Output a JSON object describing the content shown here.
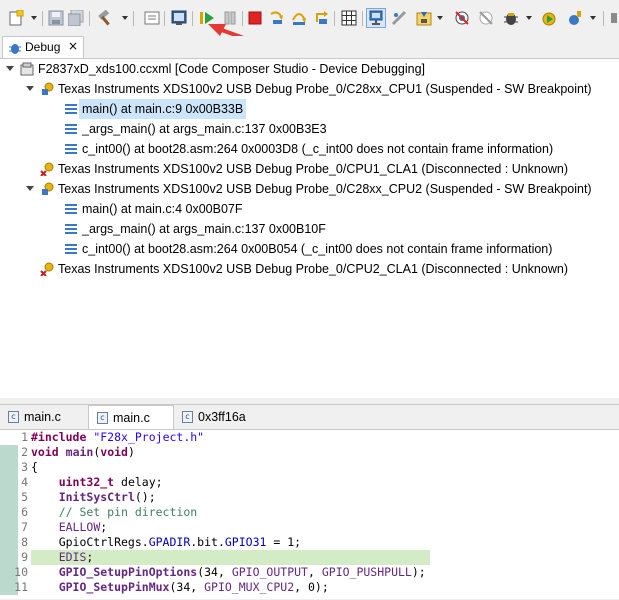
{
  "toolbar": {
    "buttons": [
      "new-icon",
      "save-icon",
      "save-all-icon",
      "build-hammer-icon",
      "properties-icon",
      "terminal-icon",
      "resume-icon",
      "suspend-icon",
      "terminate-icon",
      "step-into-icon",
      "step-over-icon",
      "step-return-icon",
      "memory-grid-icon",
      "connect-target-icon",
      "load-program-icon",
      "disable-breakpoints-icon",
      "skip-breakpoints-icon",
      "debug-bug-icon",
      "run-icon",
      "external-tools-icon"
    ]
  },
  "debug_view": {
    "tab_label": "Debug",
    "close_glyph": "×",
    "tree": [
      {
        "text": "F2837xD_xds100.ccxml [Code Composer Studio - Device Debugging]",
        "icon": "debug-config-icon",
        "level": 0
      },
      {
        "text": "Texas Instruments XDS100v2 USB Debug Probe_0/C28xx_CPU1 (Suspended - SW Breakpoint)",
        "icon": "suspended-thread-icon",
        "level": 1
      },
      {
        "text": "main() at main.c:9 0x00B33B",
        "icon": "stack-frame-icon",
        "level": 2,
        "selected": true
      },
      {
        "text": "_args_main() at args_main.c:137 0x00B3E3",
        "icon": "stack-frame-icon",
        "level": 2
      },
      {
        "text": "c_int00() at boot28.asm:264 0x0003D8  (_c_int00 does not contain frame information)",
        "icon": "stack-frame-icon",
        "level": 2
      },
      {
        "text": "Texas Instruments XDS100v2 USB Debug Probe_0/CPU1_CLA1 (Disconnected : Unknown)",
        "icon": "disconnected-thread-icon",
        "level": 1
      },
      {
        "text": "Texas Instruments XDS100v2 USB Debug Probe_0/C28xx_CPU2 (Suspended - SW Breakpoint)",
        "icon": "suspended-thread-icon",
        "level": 1
      },
      {
        "text": "main() at main.c:4 0x00B07F",
        "icon": "stack-frame-icon",
        "level": 2
      },
      {
        "text": "_args_main() at args_main.c:137 0x00B10F",
        "icon": "stack-frame-icon",
        "level": 2
      },
      {
        "text": "c_int00() at boot28.asm:264 0x00B054  (_c_int00 does not contain frame information)",
        "icon": "stack-frame-icon",
        "level": 2
      },
      {
        "text": "Texas Instruments XDS100v2 USB Debug Probe_0/CPU2_CLA1 (Disconnected : Unknown)",
        "icon": "disconnected-thread-icon",
        "level": 1
      }
    ]
  },
  "editor": {
    "tabs": [
      {
        "label": "main.c",
        "active": false
      },
      {
        "label": "main.c",
        "active": true
      },
      {
        "label": "0x3ff16a",
        "active": false
      }
    ],
    "file_icon_glyph": "c",
    "lines": [
      {
        "n": "1",
        "code": "#include \"F28x_Project.h\""
      },
      {
        "n": "2",
        "code": "void main(void)"
      },
      {
        "n": "3",
        "code": "{"
      },
      {
        "n": "4",
        "code": "    uint32_t delay;"
      },
      {
        "n": "5",
        "code": "    InitSysCtrl();"
      },
      {
        "n": "6",
        "code": "    // Set pin direction"
      },
      {
        "n": "7",
        "code": "    EALLOW;"
      },
      {
        "n": "8",
        "code": "    GpioCtrlRegs.GPADIR.bit.GPIO31 = 1;"
      },
      {
        "n": "9",
        "code": "    EDIS;"
      },
      {
        "n": "10",
        "code": "    GPIO_SetupPinOptions(34, GPIO_OUTPUT, GPIO_PUSHPULL);"
      },
      {
        "n": "11",
        "code": "    GPIO_SetupPinMux(34, GPIO_MUX_CPU2, 0);"
      }
    ],
    "current_line": "9"
  },
  "colors": {
    "selection": "#cde5fa",
    "current_line": "#d3ecc5",
    "arrow": "#e53935",
    "keyword": "#7f0055",
    "string": "#2a00ff",
    "comment": "#3f7f5f"
  }
}
